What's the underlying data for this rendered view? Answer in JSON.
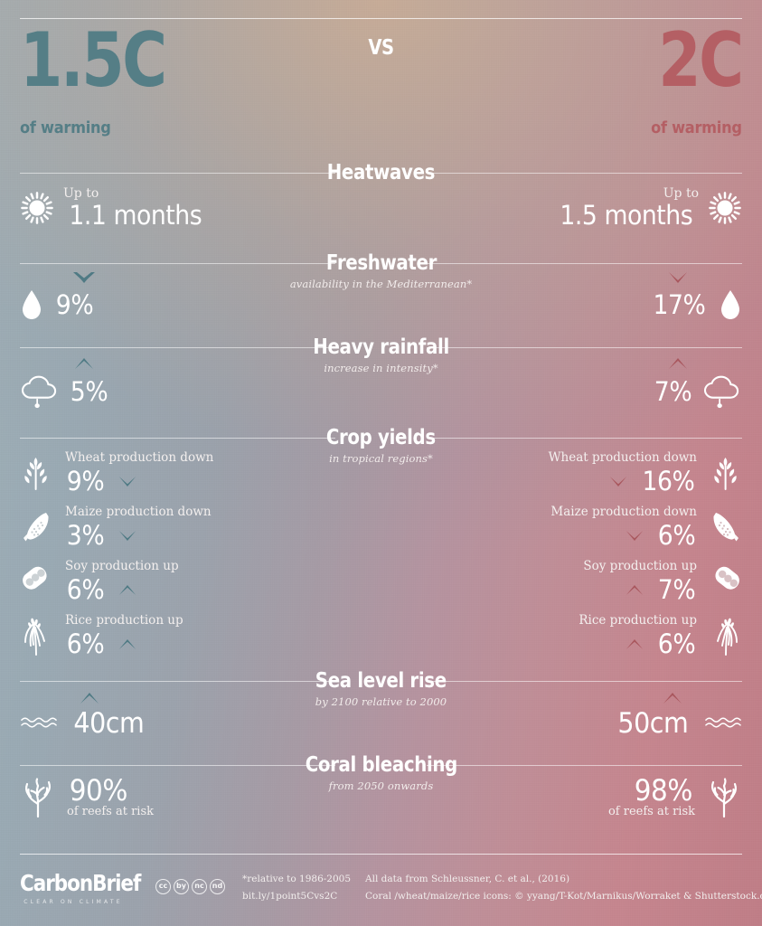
{
  "meta": {
    "vs_label": "VS",
    "accent_cool": "#557e86",
    "accent_warm": "#b45f64",
    "text_color": "#ffffff"
  },
  "header": {
    "left": {
      "temp": "1.5C",
      "subtitle": "of warming"
    },
    "right": {
      "temp": "2C",
      "subtitle": "of warming"
    }
  },
  "sections": [
    {
      "id": "heatwaves",
      "title": "Heatwaves",
      "subtitle": "",
      "icon": "sun-icon",
      "left": {
        "prefix": "Up to",
        "value": "1.1 months",
        "arrow": ""
      },
      "right": {
        "prefix": "Up to",
        "value": "1.5 months",
        "arrow": ""
      }
    },
    {
      "id": "freshwater",
      "title": "Freshwater",
      "subtitle": "availability in the Mediterranean*",
      "icon": "water-drop-icon",
      "left": {
        "value": "9%",
        "arrow": "down"
      },
      "right": {
        "value": "17%",
        "arrow": "down"
      }
    },
    {
      "id": "heavy-rainfall",
      "title": "Heavy rainfall",
      "subtitle": "increase in intensity*",
      "icon": "rain-cloud-icon",
      "left": {
        "value": "5%",
        "arrow": "up"
      },
      "right": {
        "value": "7%",
        "arrow": "up"
      }
    },
    {
      "id": "crop-yields",
      "title": "Crop yields",
      "subtitle": "in tropical regions*",
      "crops": [
        {
          "icon": "wheat-icon",
          "label": "Wheat production down",
          "left": {
            "value": "9%",
            "arrow": "down"
          },
          "right": {
            "value": "16%",
            "arrow": "down"
          }
        },
        {
          "icon": "maize-icon",
          "label": "Maize production down",
          "left": {
            "value": "3%",
            "arrow": "down"
          },
          "right": {
            "value": "6%",
            "arrow": "down"
          }
        },
        {
          "icon": "soy-icon",
          "label": "Soy production up",
          "left": {
            "value": "6%",
            "arrow": "up"
          },
          "right": {
            "value": "7%",
            "arrow": "up"
          }
        },
        {
          "icon": "rice-icon",
          "label": "Rice production up",
          "left": {
            "value": "6%",
            "arrow": "up"
          },
          "right": {
            "value": "6%",
            "arrow": "up"
          }
        }
      ]
    },
    {
      "id": "sea-level-rise",
      "title": "Sea level rise",
      "subtitle": "by 2100 relative to 2000",
      "icon": "waves-icon",
      "left": {
        "value": "40cm",
        "arrow": "up"
      },
      "right": {
        "value": "50cm",
        "arrow": "up"
      }
    },
    {
      "id": "coral-bleaching",
      "title": "Coral bleaching",
      "subtitle": "from 2050 onwards",
      "icon": "coral-icon",
      "left": {
        "value": "90%",
        "note": "of reefs at risk"
      },
      "right": {
        "value": "98%",
        "note": "of reefs at risk"
      }
    }
  ],
  "footer": {
    "logo_word": "CarbonBrief",
    "logo_tagline": "CLEAR ON CLIMATE",
    "cc_badges": [
      "cc",
      "by",
      "nc",
      "nd"
    ],
    "note_relative": "*relative to 1986-2005",
    "short_link": "bit.ly/1point5Cvs2C",
    "data_source": "All data from Schleussner, C. et al., (2016)",
    "icon_credit": "Coral /wheat/maize/rice icons: © yyang/T-Kot/Marnikus/Worraket & Shutterstock.com"
  }
}
